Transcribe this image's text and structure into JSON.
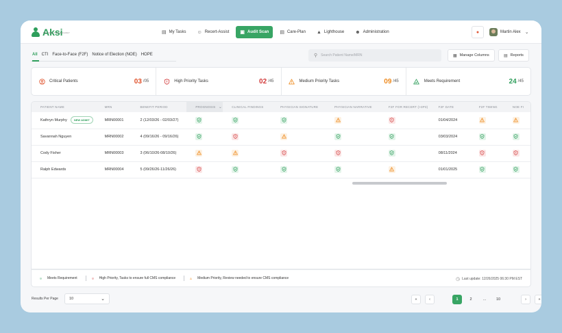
{
  "brand": {
    "name": "Aksi",
    "sub": "BY NUBO TECHNOLOGY"
  },
  "nav": [
    {
      "label": "My Tasks",
      "icon": "document-icon"
    },
    {
      "label": "Recert-Assist",
      "icon": "users-icon"
    },
    {
      "label": "Audit Scan",
      "icon": "scan-icon",
      "active": true
    },
    {
      "label": "Care-Plan",
      "icon": "clipboard-icon"
    },
    {
      "label": "Lighthouse",
      "icon": "lighthouse-icon"
    },
    {
      "label": "Administration",
      "icon": "admin-icon"
    }
  ],
  "user": {
    "name": "Martin Alex"
  },
  "tabs": [
    "All",
    "CTI",
    "Face-to-Face (F2F)",
    "Notice of Election (NOE)",
    "HOPE"
  ],
  "search": {
    "placeholder": "Search Patient Name/MRN"
  },
  "buttons": {
    "manage_columns": "Manage Columns",
    "reports": "Reports"
  },
  "stats": [
    {
      "label": "Critical Patients",
      "value": "03",
      "total": "/05",
      "color": "#e0522b"
    },
    {
      "label": "High Priority Tasks",
      "value": "02",
      "total": "/45",
      "color": "#d23b3b"
    },
    {
      "label": "Medium Priority Tasks",
      "value": "09",
      "total": "/45",
      "color": "#ee8a1e"
    },
    {
      "label": "Meets Requirement",
      "value": "24",
      "total": "/45",
      "color": "#2e9e5b"
    }
  ],
  "table": {
    "columns": [
      "PATIENT NAME",
      "MRN",
      "BENEFIT PERIOD",
      "PROGNOSIS",
      "CLINICAL FINDINGS",
      "PHYSICIAN SIGNATURE",
      "PHYSICIAN NARRATIVE",
      "F2F FOR RECERT (>3P3)",
      "F2F DATE",
      "F2F TIMING",
      "NOE FI"
    ],
    "new_admit_label": "NEW ADMIT",
    "rows": [
      {
        "name": "Kathryn Murphy",
        "new_admit": true,
        "mrn": "MRN00001",
        "period": "2 (12/03/26 - 02/03/27)",
        "statuses": [
          "ok",
          "ok",
          "ok",
          "med",
          "high"
        ],
        "f2f_date": "01/04/2024",
        "timing": "med",
        "noe": "med"
      },
      {
        "name": "Savannah Nguyen",
        "new_admit": false,
        "mrn": "MRN00002",
        "period": "4 (09/16/26 - 09/16/26)",
        "statuses": [
          "ok",
          "high",
          "med",
          "ok",
          "ok"
        ],
        "f2f_date": "03/03/2024",
        "timing": "ok",
        "noe": "ok"
      },
      {
        "name": "Cody Fisher",
        "new_admit": false,
        "mrn": "MRN00003",
        "period": "3 (06/10/26-08/10/26)",
        "statuses": [
          "med",
          "med",
          "high",
          "high",
          "ok"
        ],
        "f2f_date": "08/11/2024",
        "timing": "high",
        "noe": "high"
      },
      {
        "name": "Ralph Edwards",
        "new_admit": false,
        "mrn": "MRN00004",
        "period": "5 (09/26/26-11/26/26)",
        "statuses": [
          "high",
          "ok",
          "ok",
          "ok",
          "med"
        ],
        "f2f_date": "01/01/2025",
        "timing": "ok",
        "noe": "ok"
      }
    ]
  },
  "legend": [
    {
      "label": "Meets Requirement",
      "type": "ok"
    },
    {
      "label": "High Priority, Tasks to ensure full CMS compliance",
      "type": "high"
    },
    {
      "label": "Medium Priority, Review needed to ensure CMS compliance",
      "type": "med"
    }
  ],
  "last_update": "Last update: 12/26/2025 06:30 PM EST",
  "pagination": {
    "per_page_label": "Results Per Page",
    "per_page": "10",
    "pages": [
      "1",
      "2",
      "...",
      "10"
    ],
    "current": "1"
  },
  "colors": {
    "accent": "#38a564",
    "ok": "#2e9e5b",
    "high": "#d23b3b",
    "med": "#ee8a1e"
  }
}
